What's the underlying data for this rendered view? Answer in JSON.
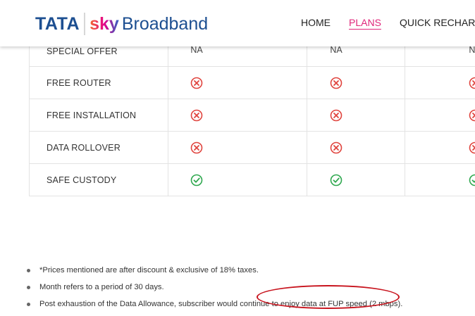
{
  "header": {
    "logo": {
      "tata": "TATA",
      "sky": "sky",
      "broadband": "Broadband"
    },
    "nav": {
      "home": "HOME",
      "plans": "PLANS",
      "quick_recharge": "QUICK RECHARGE"
    }
  },
  "table": {
    "rows": [
      {
        "label": "SPECIAL OFFER",
        "values": [
          "NA",
          "NA",
          "NA"
        ]
      },
      {
        "label": "FREE ROUTER",
        "values": [
          "cross-icon",
          "cross-icon",
          "cross-icon"
        ]
      },
      {
        "label": "FREE INSTALLATION",
        "values": [
          "cross-icon",
          "cross-icon",
          "cross-icon"
        ]
      },
      {
        "label": "DATA ROLLOVER",
        "values": [
          "cross-icon",
          "cross-icon",
          "cross-icon"
        ]
      },
      {
        "label": "SAFE CUSTODY",
        "values": [
          "check-icon",
          "check-icon",
          "check-icon"
        ]
      }
    ]
  },
  "notes": [
    "*Prices mentioned are after discount & exclusive of 18% taxes.",
    "Month refers to a period of 30 days.",
    "Post exhaustion of the Data Allowance, subscriber would continue to enjoy data at FUP speed (2 mbps)."
  ],
  "colors": {
    "brand_blue": "#1d4f91",
    "accent_pink": "#e0267a",
    "cross_red": "#e0443e",
    "check_green": "#2fa84f",
    "annotation_red": "#c8141e"
  }
}
